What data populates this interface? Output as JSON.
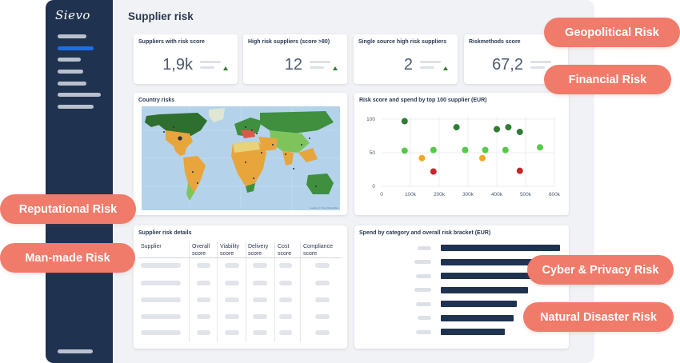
{
  "app": {
    "logo": "Sievo",
    "page_title": "Supplier risk"
  },
  "sidebar": {
    "items": [
      {
        "icon": "nav-placeholder",
        "active": false
      },
      {
        "icon": "nav-placeholder",
        "active": true
      },
      {
        "icon": "nav-placeholder",
        "active": false
      },
      {
        "icon": "nav-placeholder",
        "active": false
      },
      {
        "icon": "nav-placeholder",
        "active": false
      },
      {
        "icon": "nav-placeholder",
        "active": false
      },
      {
        "icon": "nav-placeholder",
        "active": false
      }
    ]
  },
  "kpis": [
    {
      "title": "Suppliers with risk score",
      "value": "1,9k",
      "trend": "up"
    },
    {
      "title": "High risk suppliers (score >80)",
      "value": "12",
      "trend": "up"
    },
    {
      "title": "Single source high risk suppliers",
      "value": "2",
      "trend": "up"
    },
    {
      "title": "Riskmethods score",
      "value": "67,2",
      "trend": "up"
    }
  ],
  "country_risks": {
    "title": "Country risks",
    "attribution": "Leaflet | © OpenStreetMap"
  },
  "scatter": {
    "title": "Risk score and spend by top 100 supplier (EUR)",
    "colors": {
      "high": "#2e7d32",
      "medium": "#57c94a",
      "low": "#f5a623",
      "critical": "#c62828"
    }
  },
  "chart_data": {
    "type": "scatter",
    "title": "Risk score and spend by top 100 supplier (EUR)",
    "x_ticks": [
      "0",
      "100k",
      "200k",
      "300k",
      "400k",
      "500k",
      "600k"
    ],
    "y_ticks": [
      "0",
      "50",
      "100"
    ],
    "xlim": [
      0,
      600000
    ],
    "ylim": [
      0,
      100
    ],
    "grid": true,
    "points": [
      {
        "x": 80000,
        "y": 97,
        "color": "dark-green"
      },
      {
        "x": 260000,
        "y": 88,
        "color": "dark-green"
      },
      {
        "x": 400000,
        "y": 85,
        "color": "dark-green"
      },
      {
        "x": 440000,
        "y": 88,
        "color": "dark-green"
      },
      {
        "x": 480000,
        "y": 81,
        "color": "dark-green"
      },
      {
        "x": 80000,
        "y": 53,
        "color": "light-green"
      },
      {
        "x": 180000,
        "y": 54,
        "color": "light-green"
      },
      {
        "x": 290000,
        "y": 54,
        "color": "light-green"
      },
      {
        "x": 360000,
        "y": 54,
        "color": "light-green"
      },
      {
        "x": 430000,
        "y": 54,
        "color": "light-green"
      },
      {
        "x": 550000,
        "y": 58,
        "color": "light-green"
      },
      {
        "x": 140000,
        "y": 42,
        "color": "orange"
      },
      {
        "x": 350000,
        "y": 42,
        "color": "orange"
      },
      {
        "x": 180000,
        "y": 22,
        "color": "red"
      },
      {
        "x": 480000,
        "y": 23,
        "color": "red"
      }
    ]
  },
  "details": {
    "title": "Supplier risk details",
    "columns": [
      "Supplier",
      "Overall score",
      "Viability score",
      "Delivery score",
      "Cost score",
      "Compliance score"
    ]
  },
  "spend": {
    "title": "Spend by category and overall risk bracket (EUR)",
    "bars_relative": [
      1.0,
      0.88,
      0.82,
      0.73,
      0.64,
      0.61,
      0.54
    ]
  },
  "risk_pills": {
    "geopolitical": "Geopolitical Risk",
    "financial": "Financial Risk",
    "reputational": "Reputational Risk",
    "man_made": "Man-made Risk",
    "cyber": "Cyber & Privacy Risk",
    "natural": "Natural Disaster Risk"
  }
}
